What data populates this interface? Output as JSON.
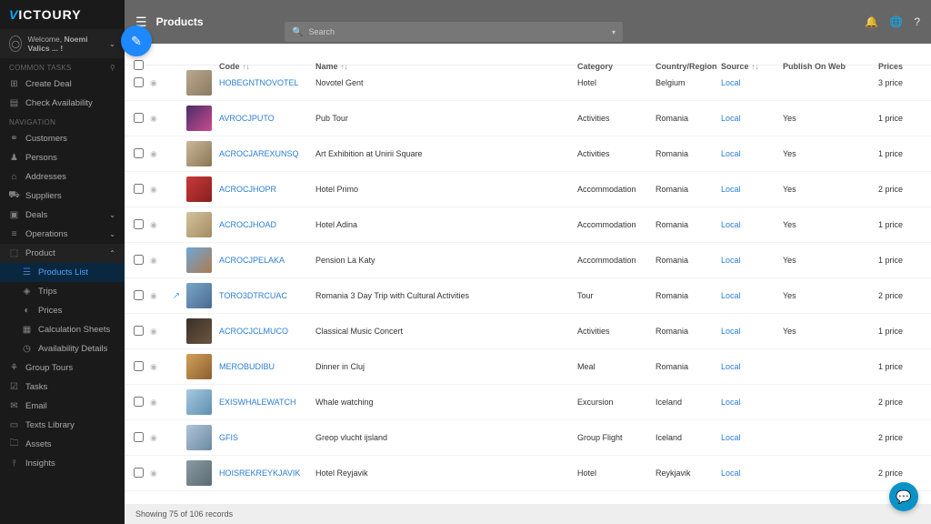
{
  "brand": "VICTOURY",
  "welcome": {
    "prefix": "Welcome,",
    "name": "Noemi Valics ... !"
  },
  "sections": {
    "common": "COMMON TASKS",
    "navigation": "NAVIGATION"
  },
  "nav": {
    "create_deal": "Create Deal",
    "check_avail": "Check Availability",
    "customers": "Customers",
    "persons": "Persons",
    "addresses": "Addresses",
    "suppliers": "Suppliers",
    "deals": "Deals",
    "operations": "Operations",
    "product": "Product",
    "products_list": "Products List",
    "trips": "Trips",
    "prices": "Prices",
    "calc_sheets": "Calculation Sheets",
    "avail_details": "Availability Details",
    "group_tours": "Group Tours",
    "tasks": "Tasks",
    "email": "Email",
    "texts_library": "Texts Library",
    "assets": "Assets",
    "insights": "Insights"
  },
  "page_title": "Products",
  "search_placeholder": "Search",
  "columns": {
    "code": "Code",
    "name": "Name",
    "category": "Category",
    "country": "Country/Region",
    "source": "Source",
    "publish": "Publish On Web",
    "prices": "Prices"
  },
  "rows": [
    {
      "code": "HOBEGNTNOVOTEL",
      "name": "Novotel Gent",
      "category": "Hotel",
      "country": "Belgium",
      "source": "Local",
      "publish": "",
      "prices": "3 price",
      "ext": false
    },
    {
      "code": "AVROCJPUTO",
      "name": "Pub Tour",
      "category": "Activities",
      "country": "Romania",
      "source": "Local",
      "publish": "Yes",
      "prices": "1 price",
      "ext": false
    },
    {
      "code": "ACROCJAREXUNSQ",
      "name": "Art Exhibition at Unirii Square",
      "category": "Activities",
      "country": "Romania",
      "source": "Local",
      "publish": "Yes",
      "prices": "1 price",
      "ext": false
    },
    {
      "code": "ACROCJHOPR",
      "name": "Hotel Primo",
      "category": "Accommodation",
      "country": "Romania",
      "source": "Local",
      "publish": "Yes",
      "prices": "2 price",
      "ext": false
    },
    {
      "code": "ACROCJHOAD",
      "name": "Hotel Adina",
      "category": "Accommodation",
      "country": "Romania",
      "source": "Local",
      "publish": "Yes",
      "prices": "1 price",
      "ext": false
    },
    {
      "code": "ACROCJPELAKA",
      "name": "Pension La Katy",
      "category": "Accommodation",
      "country": "Romania",
      "source": "Local",
      "publish": "Yes",
      "prices": "1 price",
      "ext": false
    },
    {
      "code": "TORO3DTRCUAC",
      "name": "Romania 3 Day Trip with Cultural Activities",
      "category": "Tour",
      "country": "Romania",
      "source": "Local",
      "publish": "Yes",
      "prices": "2 price",
      "ext": true
    },
    {
      "code": "ACROCJCLMUCO",
      "name": "Classical Music Concert",
      "category": "Activities",
      "country": "Romania",
      "source": "Local",
      "publish": "Yes",
      "prices": "1 price",
      "ext": false
    },
    {
      "code": "MEROBUDIBU",
      "name": "Dinner in Cluj",
      "category": "Meal",
      "country": "Romania",
      "source": "Local",
      "publish": "",
      "prices": "1 price",
      "ext": false
    },
    {
      "code": "EXISWHALEWATCH",
      "name": "Whale watching",
      "category": "Excursion",
      "country": "Iceland",
      "source": "Local",
      "publish": "",
      "prices": "2 price",
      "ext": false
    },
    {
      "code": "GFIS",
      "name": "Greop vlucht ijsland",
      "category": "Group Flight",
      "country": "Iceland",
      "source": "Local",
      "publish": "",
      "prices": "2 price",
      "ext": false
    },
    {
      "code": "HOISREKREYKJAVIK",
      "name": "Hotel Reyjavik",
      "category": "Hotel",
      "country": "Reykjavik",
      "source": "Local",
      "publish": "",
      "prices": "2 price",
      "ext": false
    }
  ],
  "footer": "Showing 75 of 106 records"
}
